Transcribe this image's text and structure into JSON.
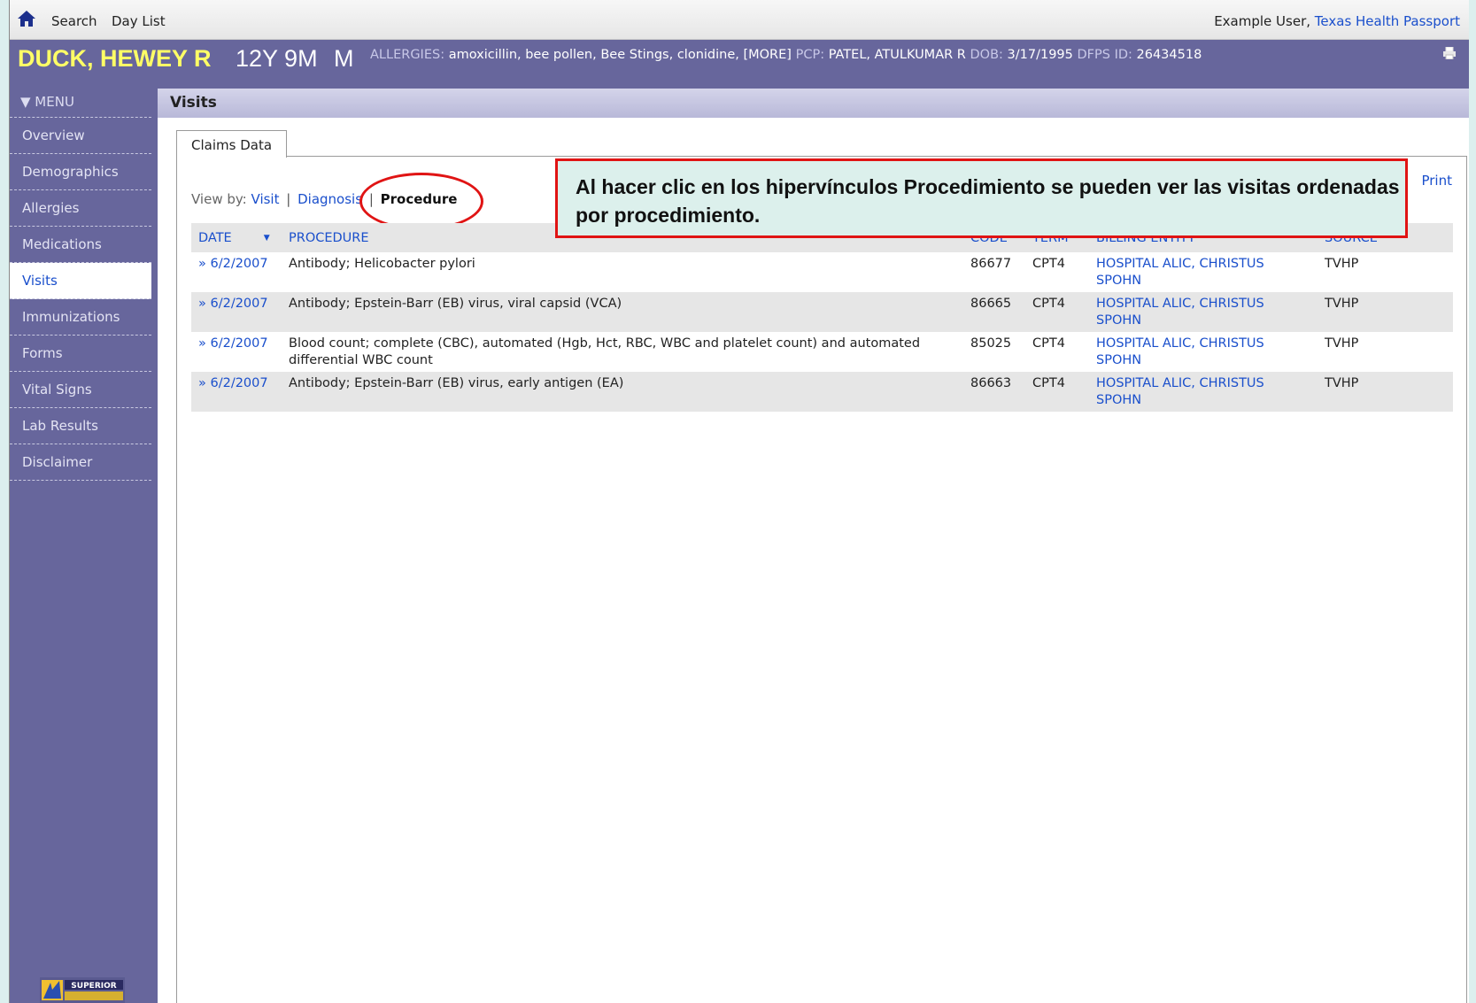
{
  "topbar": {
    "search_label": "Search",
    "daylist_label": "Day List",
    "user_name": "Example User,",
    "org_link": "Texas Health Passport"
  },
  "patient": {
    "name": "DUCK, HEWEY R",
    "age": "12Y 9M",
    "sex": "M",
    "allergies_label": "ALLERGIES:",
    "allergies_value": "amoxicillin, bee pollen, Bee Stings, clonidine, [MORE]",
    "pcp_label": "PCP:",
    "pcp_value": "PATEL, ATULKUMAR R",
    "dob_label": "DOB:",
    "dob_value": "3/17/1995",
    "dfps_label": "DFPS ID:",
    "dfps_value": "26434518"
  },
  "sidebar": {
    "menu_label": "▼ MENU",
    "items": [
      {
        "label": "Overview"
      },
      {
        "label": "Demographics"
      },
      {
        "label": "Allergies"
      },
      {
        "label": "Medications"
      },
      {
        "label": "Visits",
        "active": true
      },
      {
        "label": "Immunizations"
      },
      {
        "label": "Forms"
      },
      {
        "label": "Vital Signs"
      },
      {
        "label": "Lab Results"
      },
      {
        "label": "Disclaimer"
      }
    ],
    "logo_text": "SUPERIOR"
  },
  "content": {
    "title": "Visits",
    "tab_label": "Claims Data",
    "print_label": "Print",
    "viewby": {
      "prefix": "View by:",
      "visit": "Visit",
      "diagnosis": "Diagnosis",
      "procedure": "Procedure"
    },
    "table": {
      "headers": {
        "date": "DATE",
        "procedure": "PROCEDURE",
        "code": "CODE",
        "term": "TERM",
        "billing": "BILLING ENTITY",
        "source": "SOURCE"
      },
      "rows": [
        {
          "date": "» 6/2/2007",
          "procedure": "Antibody; Helicobacter pylori",
          "code": "86677",
          "term": "CPT4",
          "billing": "HOSPITAL ALIC, CHRISTUS SPOHN",
          "source": "TVHP"
        },
        {
          "date": "» 6/2/2007",
          "procedure": "Antibody; Epstein-Barr (EB) virus, viral capsid (VCA)",
          "code": "86665",
          "term": "CPT4",
          "billing": "HOSPITAL ALIC, CHRISTUS SPOHN",
          "source": "TVHP"
        },
        {
          "date": "» 6/2/2007",
          "procedure": "Blood count; complete (CBC), automated (Hgb, Hct, RBC, WBC and platelet count) and automated differential WBC count",
          "code": "85025",
          "term": "CPT4",
          "billing": "HOSPITAL ALIC, CHRISTUS SPOHN",
          "source": "TVHP"
        },
        {
          "date": "» 6/2/2007",
          "procedure": "Antibody; Epstein-Barr (EB) virus, early antigen (EA)",
          "code": "86663",
          "term": "CPT4",
          "billing": "HOSPITAL ALIC, CHRISTUS SPOHN",
          "source": "TVHP"
        }
      ]
    }
  },
  "callout": {
    "text": "Al hacer clic en los hipervínculos Procedimiento se pueden ver las visitas ordenadas por procedimiento."
  },
  "colors": {
    "header_purple": "#67669c",
    "patient_name_yellow": "#ffff66",
    "link_blue": "#1a4fcc",
    "callout_border": "#e01414",
    "callout_bg": "#dcf0ec"
  },
  "icons": {
    "home": "home-icon",
    "print": "printer-icon",
    "sort": "sort-down-icon"
  }
}
